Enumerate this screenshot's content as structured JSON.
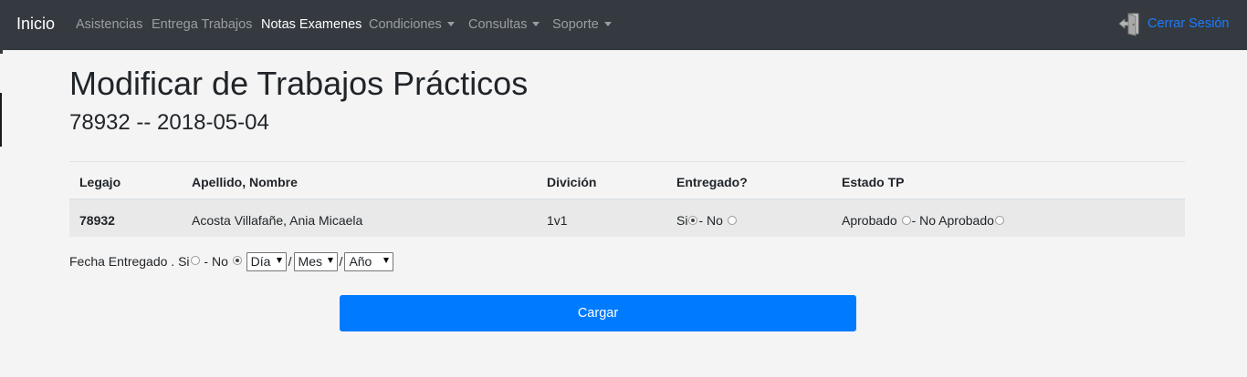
{
  "navbar": {
    "brand": "Inicio",
    "links": [
      {
        "label": "Asistencias"
      },
      {
        "label": "Entrega Trabajos"
      },
      {
        "label": "Notas Examenes"
      },
      {
        "label": "Condiciones"
      },
      {
        "label": "Consultas"
      },
      {
        "label": "Soporte"
      }
    ],
    "logout": "Cerrar Sesión",
    "logout_icon": "door-exit-icon"
  },
  "page": {
    "title": "Modificar de Trabajos Prácticos",
    "subtitle": "78932 -- 2018-05-04"
  },
  "table": {
    "headers": [
      "Legajo",
      "Apellido, Nombre",
      "Divición",
      "Entregado?",
      "Estado TP"
    ],
    "rows": [
      {
        "legajo": "78932",
        "nombre": "Acosta Villafañe, Ania Micaela",
        "division": "1v1",
        "entregado_si": "Si",
        "entregado_no": "- No",
        "entregado_selected": "Si",
        "estado_aprobado": "Aprobado",
        "estado_no_aprobado": "- No Aprobado",
        "estado_selected": ""
      }
    ]
  },
  "fecha": {
    "label": "Fecha Entregado .",
    "si": "Si",
    "no": "- No",
    "selected": "No",
    "dia": "Día",
    "mes": "Mes",
    "anio": "Año",
    "separator": "/"
  },
  "submit_label": "Cargar",
  "colors": {
    "navbar": "#343a40",
    "primary": "#007bff",
    "link": "#1e7bff",
    "background": "#f4f4f4",
    "row": "#e9e9e9"
  }
}
